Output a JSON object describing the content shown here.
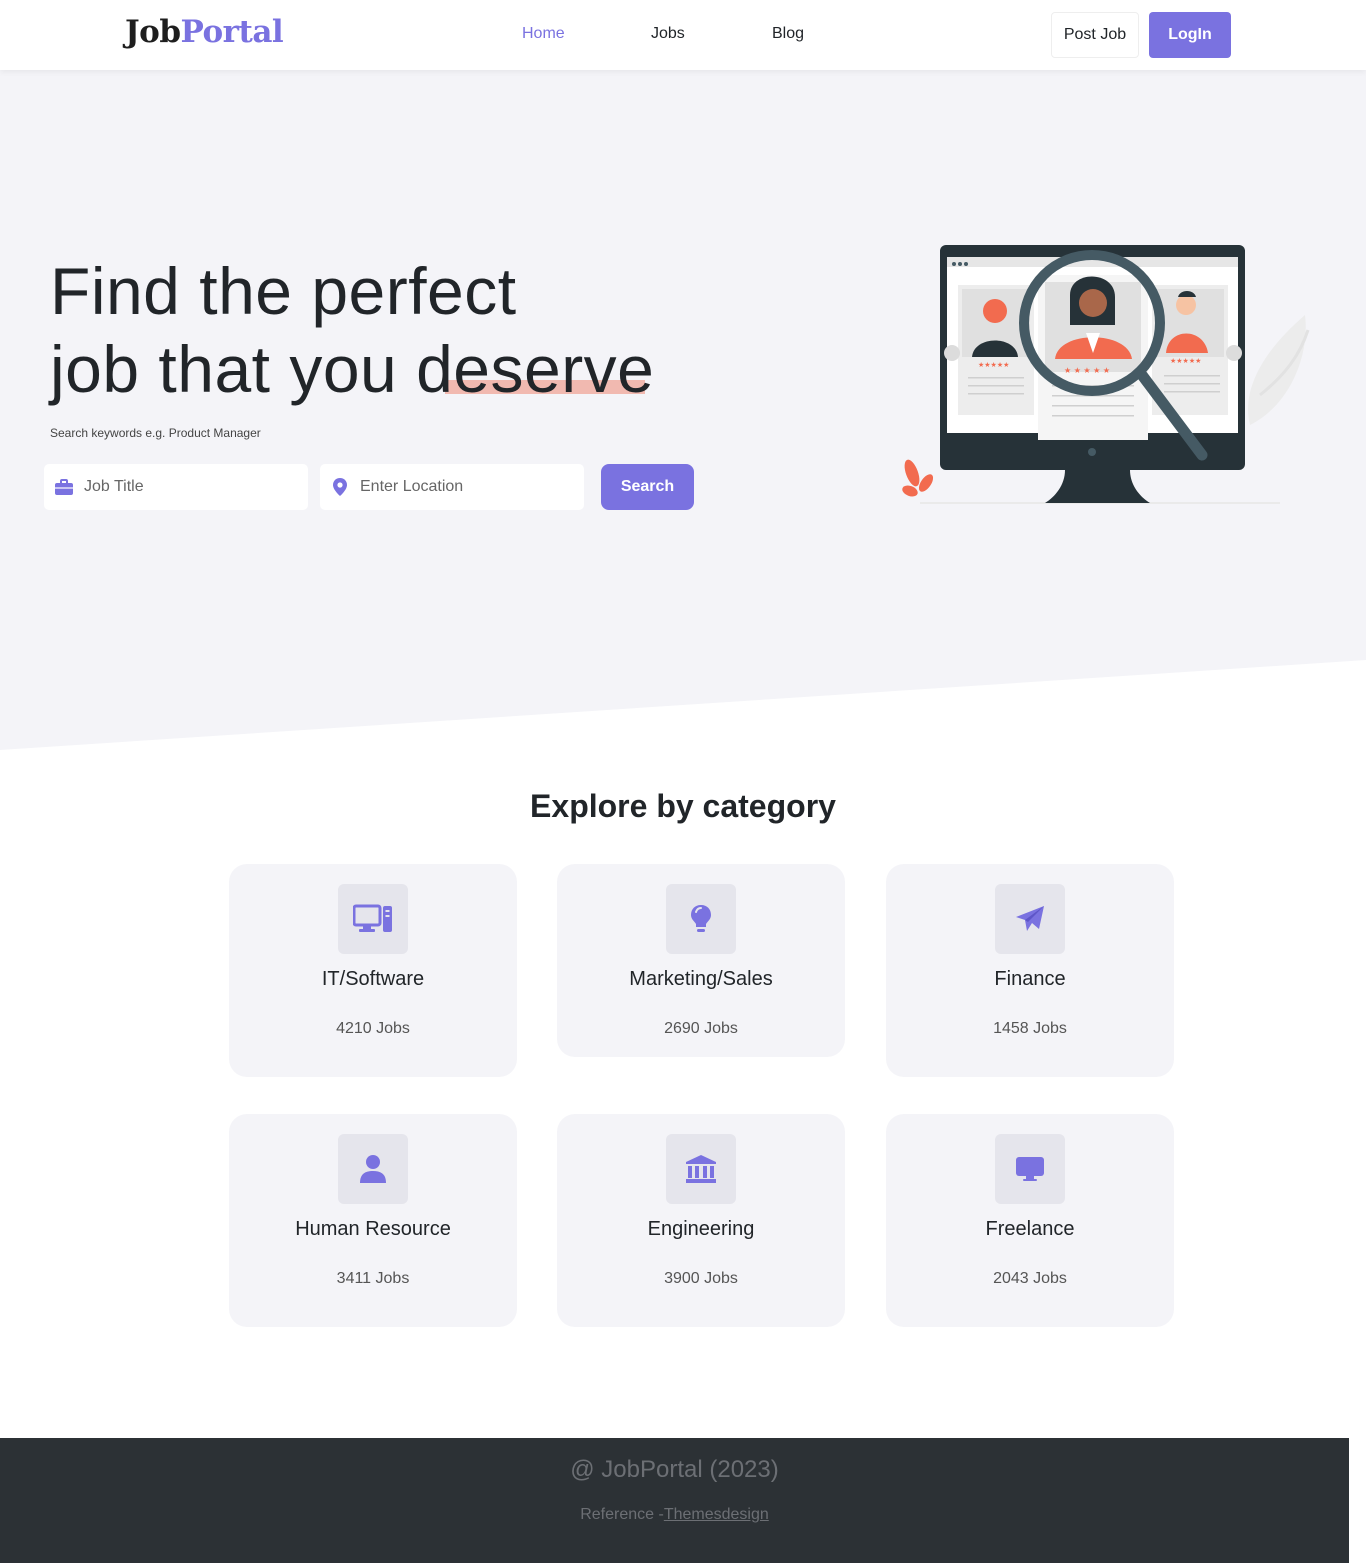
{
  "brand": {
    "part1": "Job",
    "part2": "Portal"
  },
  "nav": {
    "home": "Home",
    "jobs": "Jobs",
    "blog": "Blog"
  },
  "header_buttons": {
    "post_job": "Post Job",
    "login": "LogIn"
  },
  "hero": {
    "title_line1": "Find the perfect",
    "title_line2": "job that you deserve",
    "hint": "Search keywords e.g. Product Manager",
    "job_title_placeholder": "Job Title",
    "location_placeholder": "Enter Location",
    "search_label": "Search"
  },
  "categories": {
    "title": "Explore by category",
    "items": [
      {
        "name": "IT/Software",
        "count": "4210 Jobs",
        "icon": "desktop-icon"
      },
      {
        "name": "Marketing/Sales",
        "count": "2690 Jobs",
        "icon": "lightbulb-icon"
      },
      {
        "name": "Finance",
        "count": "1458 Jobs",
        "icon": "paper-plane-icon"
      },
      {
        "name": "Human Resource",
        "count": "3411 Jobs",
        "icon": "user-icon"
      },
      {
        "name": "Engineering",
        "count": "3900 Jobs",
        "icon": "bank-icon"
      },
      {
        "name": "Freelance",
        "count": "2043 Jobs",
        "icon": "monitor-icon"
      }
    ]
  },
  "footer": {
    "copyright": "@ JobPortal (2023)",
    "reference_prefix": "Reference -",
    "reference_link": "Themesdesign"
  },
  "colors": {
    "accent": "#7a72e0",
    "hero_bg": "#f4f4f8",
    "footer_bg": "#2c3135",
    "highlight": "#f0aea3"
  }
}
